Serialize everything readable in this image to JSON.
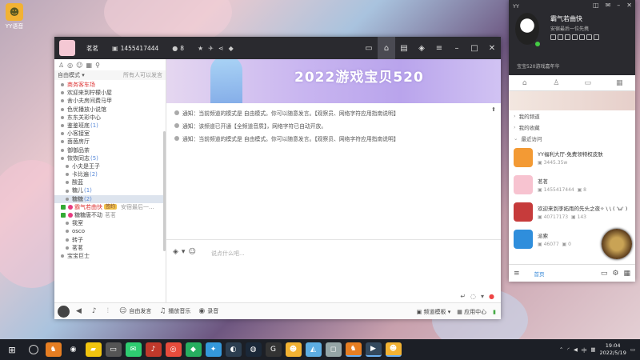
{
  "desktop": {
    "icon_label": "YY语音"
  },
  "window": {
    "channel_name": "茗茗",
    "channel_id": "1455417444",
    "member_count": "8"
  },
  "left": {
    "mode": "自由模式",
    "mode_hint": "所有人可以发言",
    "channels": [
      {
        "name": "商务客车场",
        "red": true
      },
      {
        "name": "欢迎来到柠檬小屋"
      },
      {
        "name": "舍小夫房间费马甲"
      },
      {
        "name": "色优播放小说馆"
      },
      {
        "name": "东东关彩中心"
      },
      {
        "name": "鉴鉴班底",
        "count": "(1)"
      },
      {
        "name": "小客接室"
      },
      {
        "name": "茵茵房厅"
      },
      {
        "name": "御御品茶"
      },
      {
        "name": "恢恢同志",
        "count": "(5)"
      },
      {
        "name": "小夫是王子",
        "sub": true
      },
      {
        "name": "卡比遍",
        "count": "(2)",
        "sub": true
      },
      {
        "name": "酸蓝",
        "sub": true
      },
      {
        "name": "糖儿",
        "count": "(1)",
        "sub": true
      },
      {
        "name": "糖糖",
        "count": "(2)",
        "sub": true,
        "selected": true
      }
    ],
    "users": [
      {
        "name": "霸气若曲快",
        "badge": "签约",
        "extra": "安宿最后一..."
      },
      {
        "name": "糖糖唐不动",
        "extra": "茗茗"
      }
    ],
    "channels_after": [
      {
        "name": "我室",
        "sub": true
      },
      {
        "name": "osco",
        "sub": true
      },
      {
        "name": "转子",
        "sub": true
      },
      {
        "name": "茗茗",
        "sub": true
      },
      {
        "name": "宝宝巨士"
      }
    ]
  },
  "banner": {
    "text": "2022游戏宝贝520"
  },
  "notices": [
    "通知：当前频道的模式是 自由模式。你可以随意发言。【观察员、网络字符应用指南说明】",
    "通知：该频道已开通【全频道音质】，网络字符已自动开放。",
    "通知：当前频道的模式是 自由模式。你可以随意发言。【观察员、网络字符应用指南说明】"
  ],
  "input": {
    "placeholder": "说点什么吧..."
  },
  "bottombar": {
    "free_speak": "自由发言",
    "play_music": "播放音乐",
    "record": "录音",
    "channel_template": "频道模板",
    "app_center": "应用中心"
  },
  "rightpanel": {
    "app": "YY",
    "nickname": "霸气若曲快",
    "signature": "安宿最后一位先携",
    "channel_line": "宝宝520游戏嘉年华",
    "sections": [
      "我的频道",
      "我的收藏",
      "最近访问"
    ],
    "recents": [
      {
        "name": "YY福利大厅-免费领特权皮肤",
        "stat": "3445.35w",
        "color": "#f39a34"
      },
      {
        "name": "茗茗",
        "stat": "1455417444",
        "stat2": "8",
        "color": "#f7c3d0"
      },
      {
        "name": "欢迎来到李拓雨的先头之夜✧ \\ \\ ( 'ω' )",
        "stat": "40717173",
        "stat2": "143",
        "color": "#c63b3b"
      },
      {
        "name": "派索",
        "stat": "46077",
        "stat2": "0",
        "color": "#2f8edc"
      }
    ],
    "bottom_tab": "首页"
  },
  "taskbar": {
    "clock_time": "19:04",
    "clock_date": "2022/5/19",
    "ime": "中"
  }
}
